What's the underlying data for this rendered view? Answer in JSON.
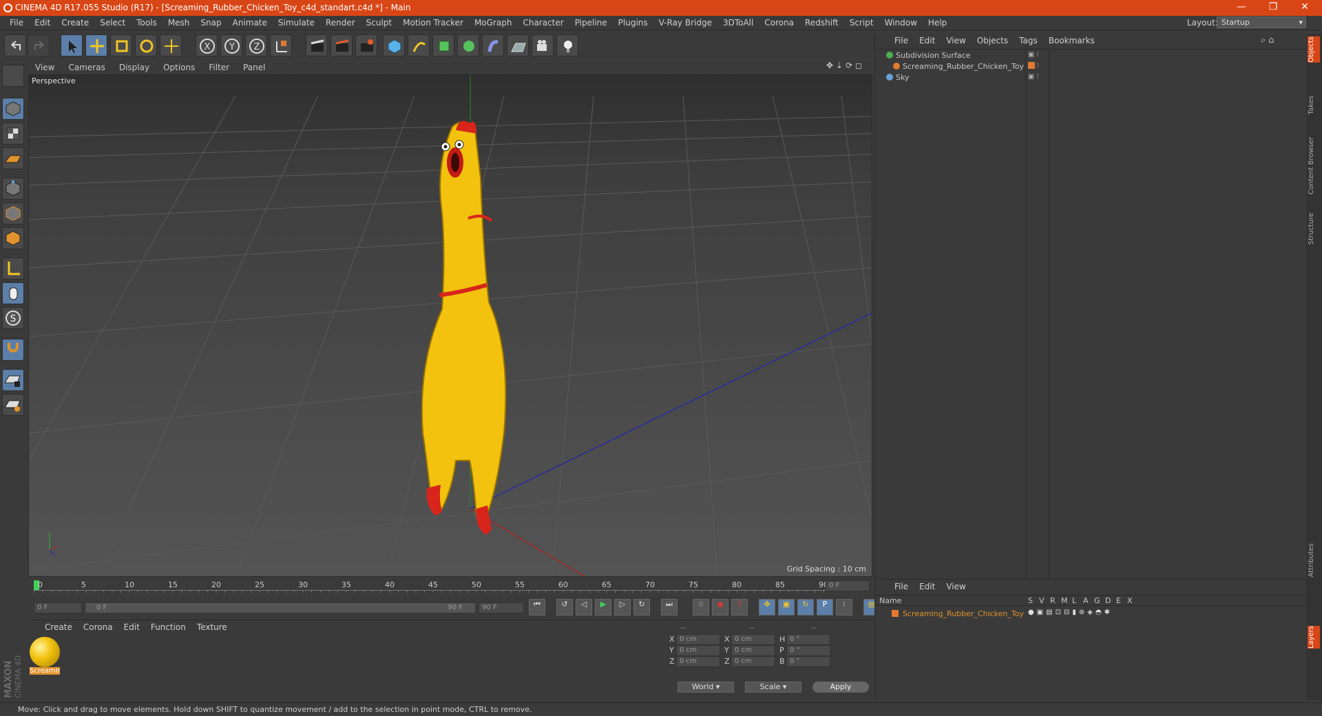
{
  "window": {
    "title": "CINEMA 4D R17.055 Studio (R17) - [Screaming_Rubber_Chicken_Toy_c4d_standart.c4d *] - Main",
    "minimize": "—",
    "restore": "❐",
    "close": "✕"
  },
  "menubar": {
    "items": [
      "File",
      "Edit",
      "Create",
      "Select",
      "Tools",
      "Mesh",
      "Snap",
      "Animate",
      "Simulate",
      "Render",
      "Sculpt",
      "Motion Tracker",
      "MoGraph",
      "Character",
      "Pipeline",
      "Plugins",
      "V-Ray Bridge",
      "3DToAll",
      "Corona",
      "Redshift",
      "Script",
      "Window",
      "Help"
    ],
    "layout_label": "Layout:",
    "layout_value": "Startup"
  },
  "viewport": {
    "menu": [
      "View",
      "Cameras",
      "Display",
      "Options",
      "Filter",
      "Panel"
    ],
    "label": "Perspective",
    "grid_spacing": "Grid Spacing : 10 cm"
  },
  "timeline": {
    "ticks": [
      "0",
      "5",
      "10",
      "15",
      "20",
      "25",
      "30",
      "35",
      "40",
      "45",
      "50",
      "55",
      "60",
      "65",
      "70",
      "75",
      "80",
      "85",
      "90"
    ],
    "current_frame": "0 F",
    "start_field": "0 F",
    "range_start": "0 F",
    "range_end": "90 F",
    "end_field": "90 F"
  },
  "materials": {
    "menu": [
      "Create",
      "Corona",
      "Edit",
      "Function",
      "Texture"
    ],
    "items": [
      {
        "label": "Screamin"
      }
    ]
  },
  "coordinates": {
    "headers": [
      "--",
      "--",
      "--"
    ],
    "rows": [
      {
        "a": "X",
        "av": "0 cm",
        "b": "X",
        "bv": "0 cm",
        "c": "H",
        "cv": "0 °"
      },
      {
        "a": "Y",
        "av": "0 cm",
        "b": "Y",
        "bv": "0 cm",
        "c": "P",
        "cv": "0 °"
      },
      {
        "a": "Z",
        "av": "0 cm",
        "b": "Z",
        "bv": "0 cm",
        "c": "B",
        "cv": "0 °"
      }
    ],
    "mode1": "World",
    "mode2": "Scale",
    "apply": "Apply"
  },
  "object_manager": {
    "menu": [
      "File",
      "Edit",
      "View",
      "Objects",
      "Tags",
      "Bookmarks"
    ],
    "objects": [
      {
        "name": "Subdivision Surface",
        "color": "#4caf50"
      },
      {
        "name": "Screaming_Rubber_Chicken_Toy",
        "color": "#e07a30"
      },
      {
        "name": "Sky",
        "color": "#6aa0d8"
      }
    ]
  },
  "layer_manager": {
    "menu": [
      "File",
      "Edit",
      "View"
    ],
    "columns": [
      "Name",
      "S",
      "V",
      "R",
      "M",
      "L",
      "A",
      "G",
      "D",
      "E",
      "X"
    ],
    "layers": [
      {
        "name": "Screaming_Rubber_Chicken_Toy",
        "color": "#e07a30"
      }
    ]
  },
  "right_tabs": [
    "Objects",
    "Takes",
    "Content Browser",
    "Structure",
    "Attributes",
    "Layers"
  ],
  "status": "Move: Click and drag to move elements. Hold down SHIFT to quantize movement / add to the selection in point mode, CTRL to remove.",
  "brand": "MAXON CINEMA 4D"
}
